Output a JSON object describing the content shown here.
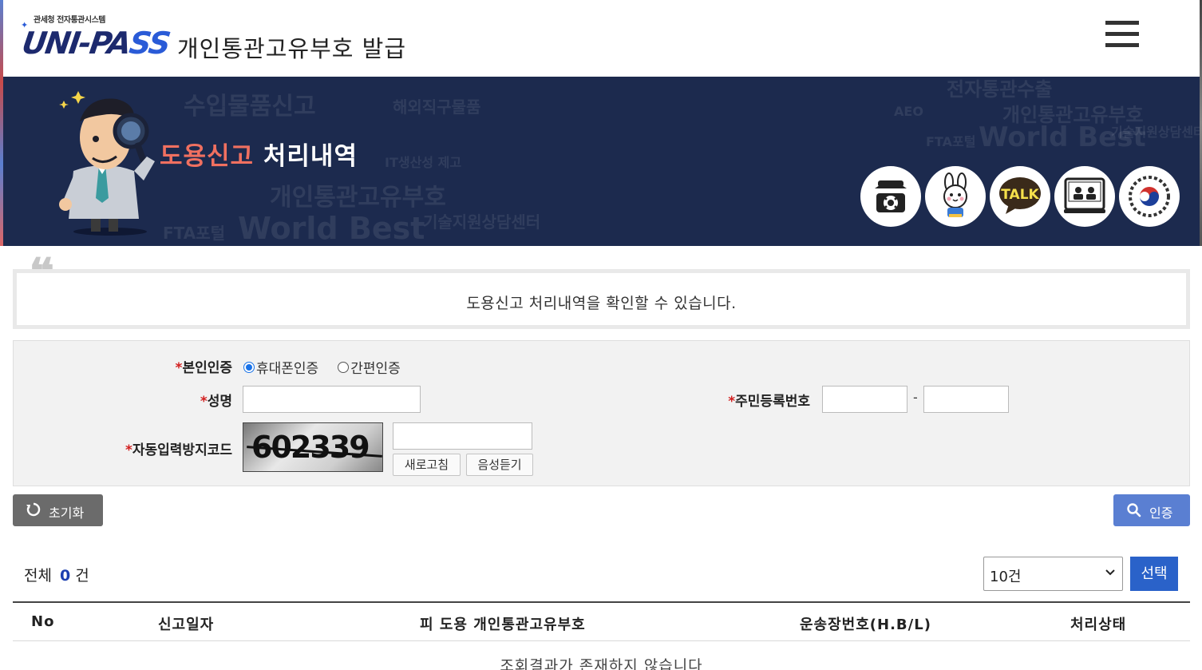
{
  "header": {
    "logo_sub": "관세청 전자통관시스템",
    "logo_main_a": "UNI-PA",
    "logo_main_b": "SS",
    "site_title": "개인통관고유부호 발급"
  },
  "banner": {
    "title_highlight": "도용신고",
    "title_rest": "처리내역",
    "background_words": [
      "수입물품신고",
      "해외직구물품",
      "IT생산성 제고",
      "개인통관고유부호",
      "FTA포털",
      "World Best",
      "기술지원상담센터",
      "전자통관수출",
      "AEO"
    ],
    "quick_links": [
      {
        "icon": "telephone-icon"
      },
      {
        "icon": "mascot-icon"
      },
      {
        "icon": "kakao-talk-icon"
      },
      {
        "icon": "remote-support-icon"
      },
      {
        "icon": "government-emblem-icon"
      }
    ]
  },
  "notice": {
    "text": "도용신고 처리내역을 확인할 수 있습니다."
  },
  "form": {
    "required_mark": "*",
    "auth_label": "본인인증",
    "auth_options": [
      {
        "label": "휴대폰인증",
        "checked": true
      },
      {
        "label": "간편인증",
        "checked": false
      }
    ],
    "name_label": "성명",
    "name_value": "",
    "rrn_label": "주민등록번호",
    "rrn_front": "",
    "rrn_back": "",
    "rrn_separator": "-",
    "captcha_label": "자동입력방지코드",
    "captcha_image_text": "602339",
    "captcha_input": "",
    "refresh_label": "새로고침",
    "listen_label": "음성듣기"
  },
  "actions": {
    "reset_label": "초기화",
    "auth_label": "인증"
  },
  "results": {
    "total_prefix": "전체",
    "total_count": "0",
    "total_suffix": "건",
    "page_size_selected": "10건",
    "select_button": "선택",
    "columns": [
      "No",
      "신고일자",
      "피 도용 개인통관고유부호",
      "운송장번호(H.B/L)",
      "처리상태"
    ],
    "empty_message": "조회결과가 존재하지 않습니다"
  },
  "colors": {
    "banner_bg": "#1c2a4e",
    "title_highlight": "#f07060",
    "primary_button": "#2a62c9",
    "auth_button": "#5a7fd2",
    "reset_button": "#6b6b6b",
    "required": "#d21f1f"
  }
}
